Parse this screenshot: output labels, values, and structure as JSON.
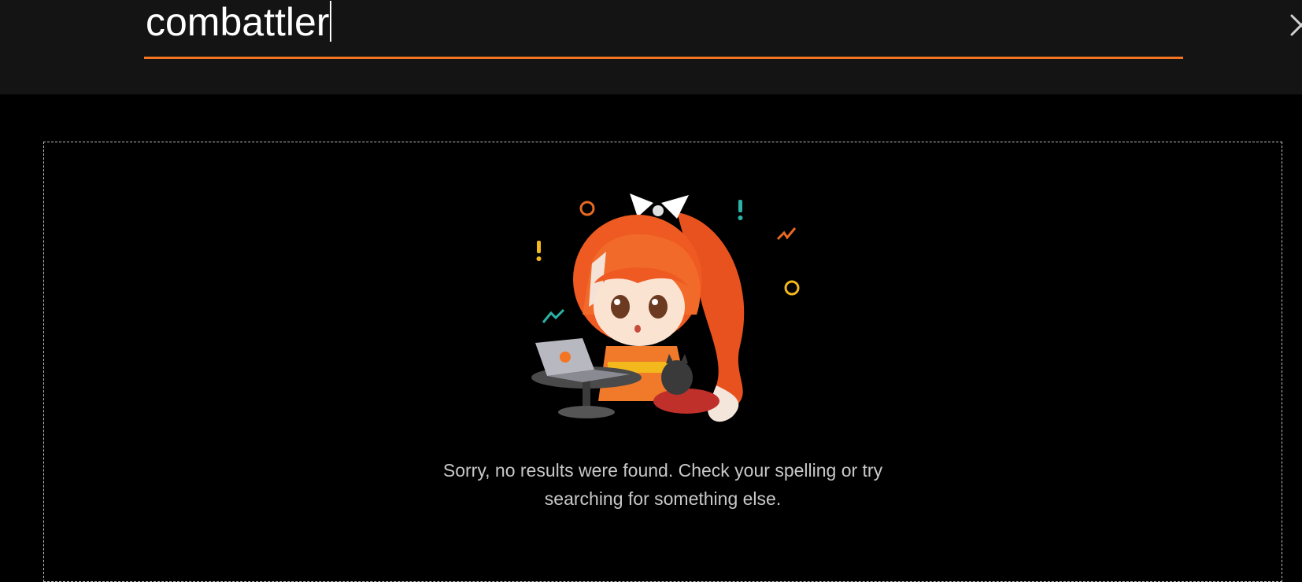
{
  "search": {
    "query": "combattler",
    "clear_icon": "close-icon",
    "accent_color": "#f47521"
  },
  "empty_state": {
    "illustration": "mascot-with-laptop",
    "message": "Sorry, no results were found. Check your spelling or try searching for something else."
  },
  "colors": {
    "header_bg": "#141414",
    "page_bg": "#000000",
    "text": "#ffffff",
    "muted_text": "#c8c8c8"
  }
}
